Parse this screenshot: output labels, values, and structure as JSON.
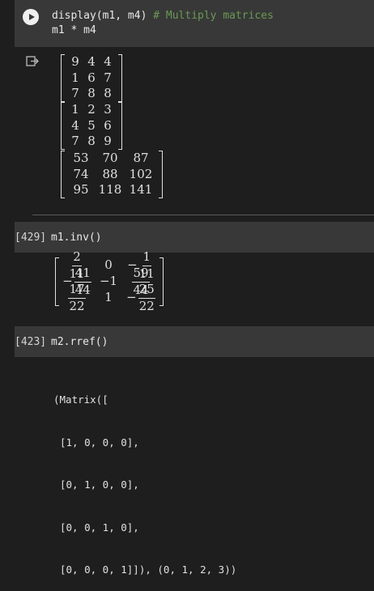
{
  "cells": [
    {
      "code_lines": [
        "display(m1, m4) ",
        "m1 * m4"
      ],
      "comment": "# Multiply matrices"
    },
    {
      "exec_count": "[429]",
      "code": "m1.inv()"
    },
    {
      "exec_count": "[423]",
      "code": "m2.rref()"
    }
  ],
  "output1": {
    "m1": [
      [
        "9",
        "4",
        "4"
      ],
      [
        "1",
        "6",
        "7"
      ],
      [
        "7",
        "8",
        "8"
      ]
    ],
    "m4": [
      [
        "1",
        "2",
        "3"
      ],
      [
        "4",
        "5",
        "6"
      ],
      [
        "7",
        "8",
        "9"
      ]
    ],
    "product": [
      [
        "53",
        "70",
        "87"
      ],
      [
        "74",
        "88",
        "102"
      ],
      [
        "95",
        "118",
        "141"
      ]
    ]
  },
  "inverse": [
    [
      {
        "n": "2",
        "d": "11"
      },
      {
        "v": "0"
      },
      {
        "neg": "−",
        "n": "1",
        "d": "11"
      }
    ],
    [
      {
        "neg": "−",
        "n": "41",
        "d": "44"
      },
      {
        "v": "−1"
      },
      {
        "n": "59",
        "d": "44"
      }
    ],
    [
      {
        "n": "17",
        "d": "22"
      },
      {
        "v": "1"
      },
      {
        "neg": "−",
        "n": "25",
        "d": "22"
      }
    ]
  ],
  "rref_lines": [
    "(Matrix([",
    "[1, 0, 0, 0],",
    "[0, 1, 0, 0],",
    "[0, 0, 1, 0],",
    "[0, 0, 0, 1]]), (0, 1, 2, 3))"
  ],
  "colors": {
    "cell_bg": "#383838",
    "page_bg": "#1e1e1e",
    "comment": "#6a9955"
  },
  "icons": [
    "run-icon",
    "output-icon"
  ]
}
